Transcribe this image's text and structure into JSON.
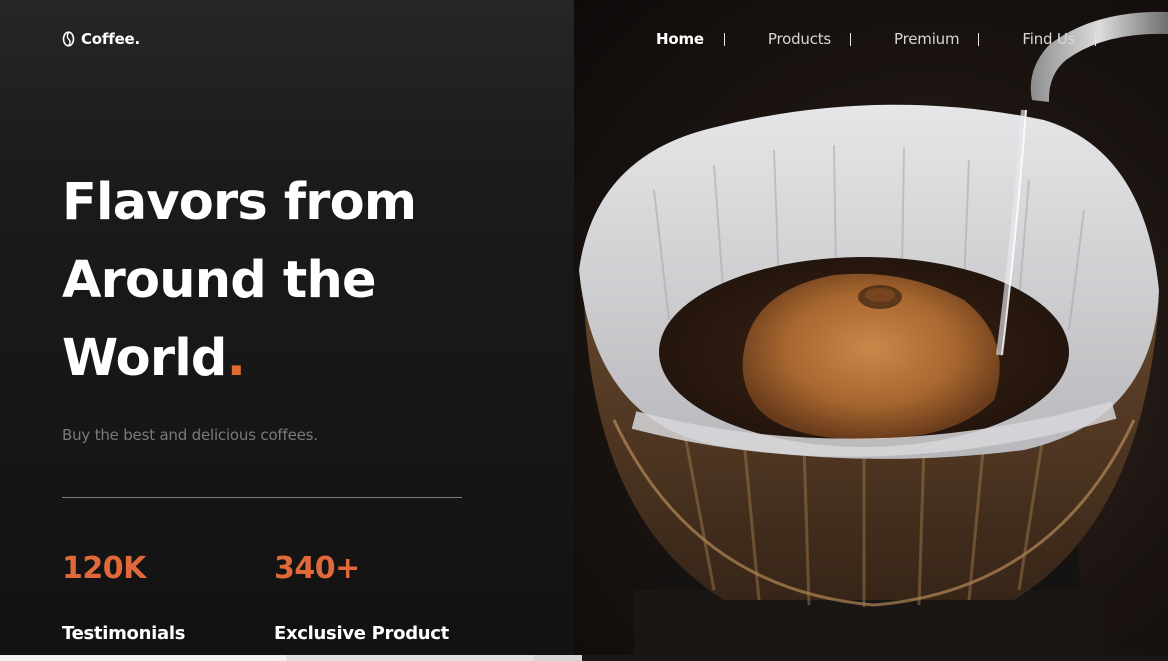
{
  "brand": {
    "name": "Coffee.",
    "icon": "coffee-bean-icon"
  },
  "nav": {
    "items": [
      {
        "label": "Home",
        "active": true
      },
      {
        "label": "Products",
        "active": false
      },
      {
        "label": "Premium",
        "active": false
      },
      {
        "label": "Find Us",
        "active": false
      }
    ]
  },
  "hero": {
    "line1": "Flavors from",
    "line2": "Around the",
    "line3": "World",
    "accent_dot": ".",
    "subtitle": "Buy the best and delicious coffees."
  },
  "stats": [
    {
      "value": "120K",
      "label": "Testimonials"
    },
    {
      "value": "340+",
      "label": "Exclusive Product"
    }
  ],
  "colors": {
    "accent": "#e0683a",
    "background": "#121212",
    "text": "#ffffff",
    "muted": "#7a7a7a"
  }
}
